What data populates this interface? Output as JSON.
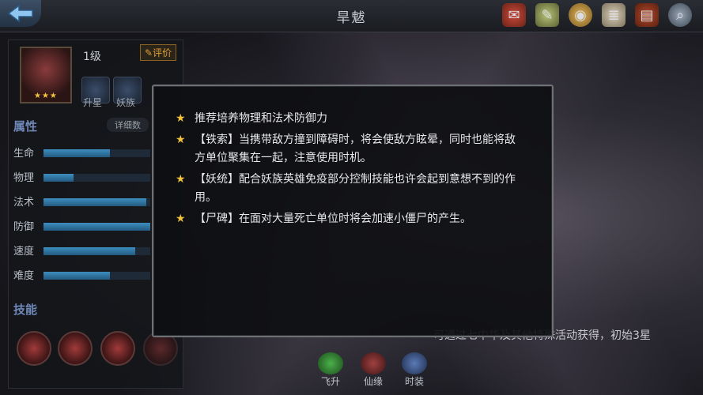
{
  "header": {
    "title": "旱魃"
  },
  "top_icons": [
    "scroll-seal-icon",
    "map-scroll-icon",
    "coin-icon",
    "document-icon",
    "book-icon",
    "magnifier-icon"
  ],
  "hero": {
    "level": "1级",
    "rate_label": "评价",
    "stars": "★★★",
    "star_count": 3
  },
  "chips": {
    "upgrade": "升星",
    "clan": "妖族"
  },
  "attributes": {
    "title": "属性",
    "detail_label": "详细数",
    "stats": [
      {
        "label": "生命",
        "fill": 0.62
      },
      {
        "label": "物理",
        "fill": 0.28
      },
      {
        "label": "法术",
        "fill": 0.96
      },
      {
        "label": "防御",
        "fill": 1.0
      },
      {
        "label": "速度",
        "fill": 0.86
      },
      {
        "label": "难度",
        "fill": 0.62
      }
    ]
  },
  "skills": {
    "title": "技能"
  },
  "bottom": {
    "obtain_text": "可通过七中华及其他特殊活动获得，初始3星",
    "tabs": [
      "飞升",
      "仙缘",
      "时装"
    ]
  },
  "tips": [
    "推荐培养物理和法术防御力",
    "【铁索】当携带敌方撞到障碍时，将会使敌方眩晕，同时也能将敌方单位聚集在一起，注意使用时机。",
    "【妖统】配合妖族英雄免疫部分控制技能也许会起到意想不到的作用。",
    "【尸碑】在面对大量死亡单位时将会加速小僵尸的产生。"
  ],
  "colors": {
    "accent": "#f2c23a",
    "bar": "#3d8ec0",
    "section": "#6f88b8"
  }
}
